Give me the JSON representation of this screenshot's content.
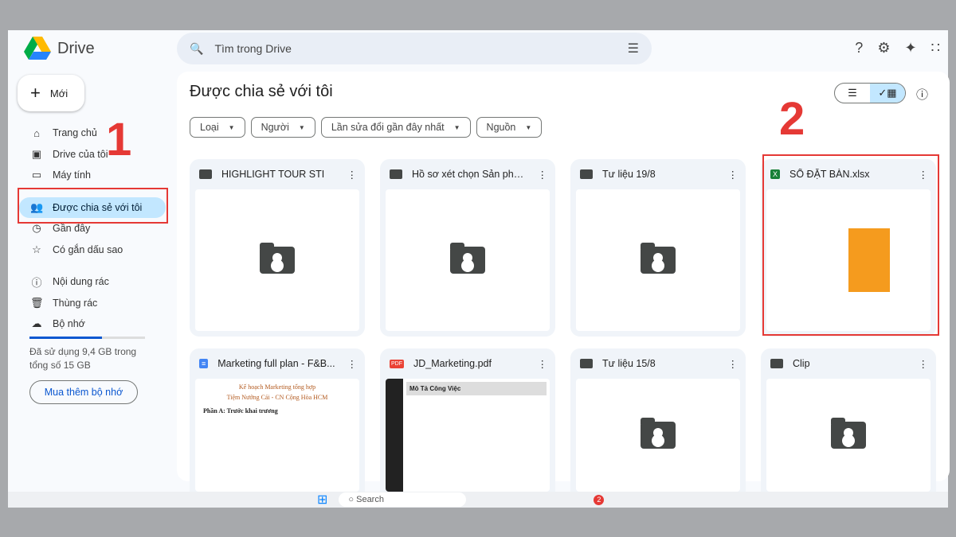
{
  "app": {
    "name": "Drive"
  },
  "search": {
    "placeholder": "Tìm trong Drive"
  },
  "new_button": "Mới",
  "nav": [
    {
      "label": "Trang chủ",
      "icon": "home-icon"
    },
    {
      "label": "Drive của tôi",
      "icon": "drive-icon"
    },
    {
      "label": "Máy tính",
      "icon": "computer-icon"
    },
    {
      "label": "Được chia sẻ với tôi",
      "icon": "shared-icon"
    },
    {
      "label": "Gần đây",
      "icon": "clock-icon"
    },
    {
      "label": "Có gắn dấu sao",
      "icon": "star-icon"
    },
    {
      "label": "Nội dung rác",
      "icon": "spam-icon"
    },
    {
      "label": "Thùng rác",
      "icon": "trash-icon"
    },
    {
      "label": "Bộ nhớ",
      "icon": "cloud-icon"
    }
  ],
  "storage": {
    "text": "Đã sử dụng 9,4 GB trong tổng số 15 GB",
    "used_fraction": 0.63,
    "buy_label": "Mua thêm bộ nhớ"
  },
  "main": {
    "title": "Được chia sẻ với tôi",
    "filters": [
      "Loại",
      "Người",
      "Lần sửa đổi gần đây nhất",
      "Nguồn"
    ],
    "files": [
      {
        "name": "HIGHLIGHT TOUR STI",
        "type": "folder"
      },
      {
        "name": "Hồ sơ xét chọn Sản phẩm,...",
        "type": "folder"
      },
      {
        "name": "Tư liệu 19/8",
        "type": "folder"
      },
      {
        "name": "SỔ ĐẶT BÀN.xlsx",
        "type": "xlsx"
      },
      {
        "name": "Marketing full plan - F&B...",
        "type": "doc",
        "preview": [
          "Kế hoạch Marketing tổng hợp",
          "Tiệm Nướng Cái - CN Cộng Hòa HCM",
          "Phần A: Trước khai trương"
        ]
      },
      {
        "name": "JD_Marketing.pdf",
        "type": "pdf",
        "preview": [
          "Mô Tả Công Việc"
        ]
      },
      {
        "name": "Tư liệu 15/8",
        "type": "folder"
      },
      {
        "name": "Clip",
        "type": "folder"
      }
    ]
  },
  "annotations": [
    "1",
    "2"
  ],
  "taskbar": {
    "search": "Search",
    "badge": "2"
  }
}
